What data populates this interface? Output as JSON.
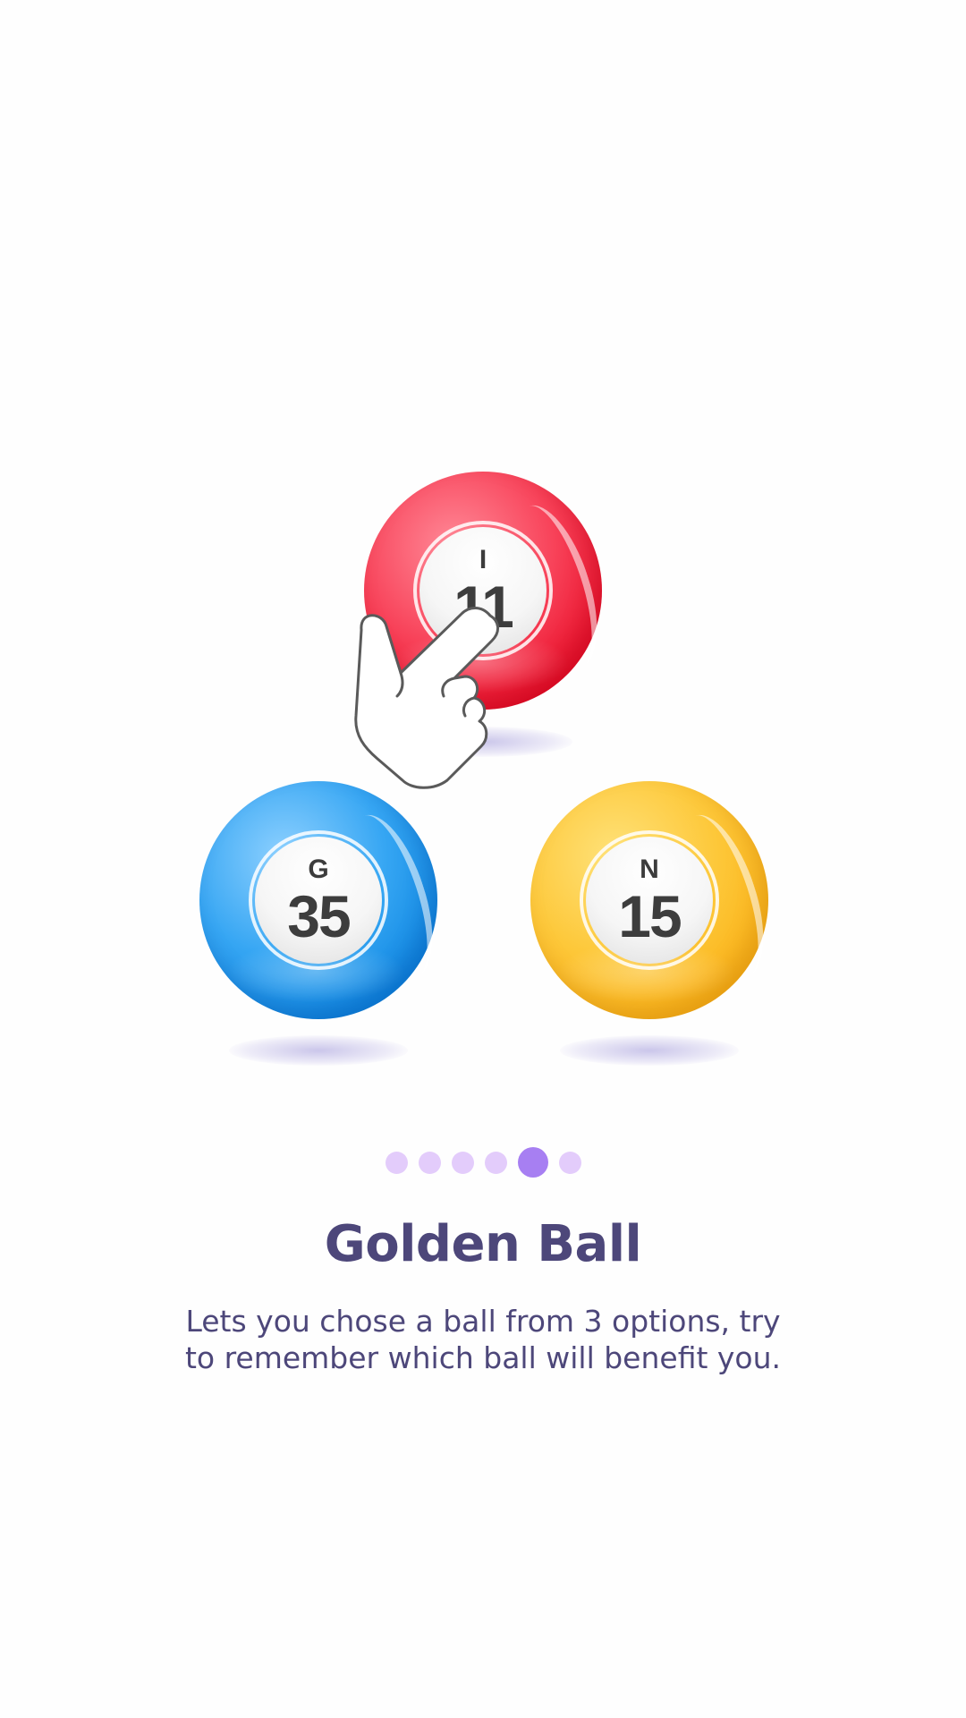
{
  "onboarding": {
    "balls": [
      {
        "letter": "I",
        "number": "11",
        "color": "#f0223c"
      },
      {
        "letter": "G",
        "number": "35",
        "color": "#1a93ea"
      },
      {
        "letter": "N",
        "number": "15",
        "color": "#fcbd22"
      }
    ],
    "pagination": {
      "total": 6,
      "active_index": 4,
      "active_color": "#a77ff2",
      "inactive_color": "#e3ccfb"
    },
    "title": "Golden Ball",
    "description_lines": [
      "Lets you chose a ball from 3 options, try",
      "to remember which ball will benefit you."
    ],
    "icons": {
      "pointer": "hand-pointer-icon"
    }
  }
}
